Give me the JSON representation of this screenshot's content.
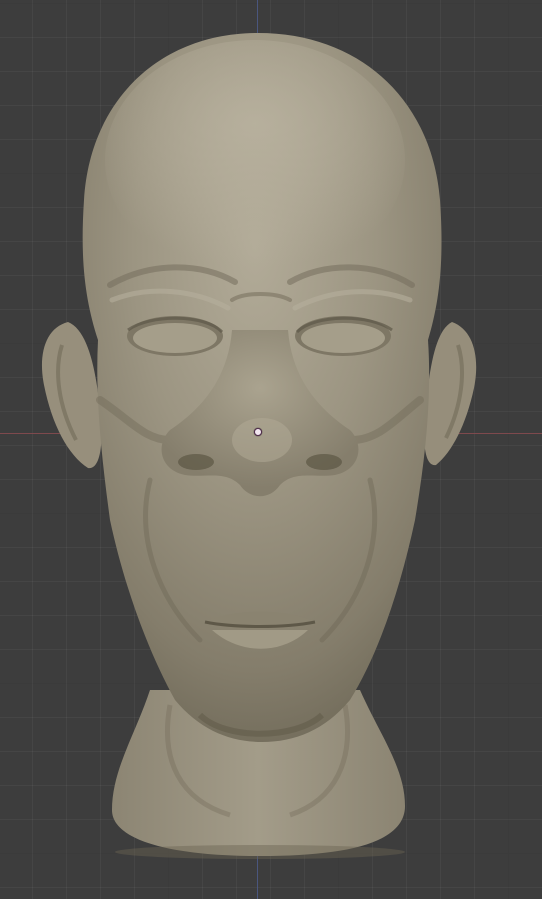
{
  "viewport": {
    "background_color": "#3d3d3d",
    "grid_color": "#474747",
    "x_axis_color": "#8a4b50",
    "y_axis_color": "#4c5a8a"
  },
  "sculpt": {
    "object": "bald-head-bust",
    "material_color": "#9a937f",
    "shading": "matcap-clay"
  },
  "origin": {
    "icon": "object-origin-dot",
    "color": "#f3e7f0"
  }
}
